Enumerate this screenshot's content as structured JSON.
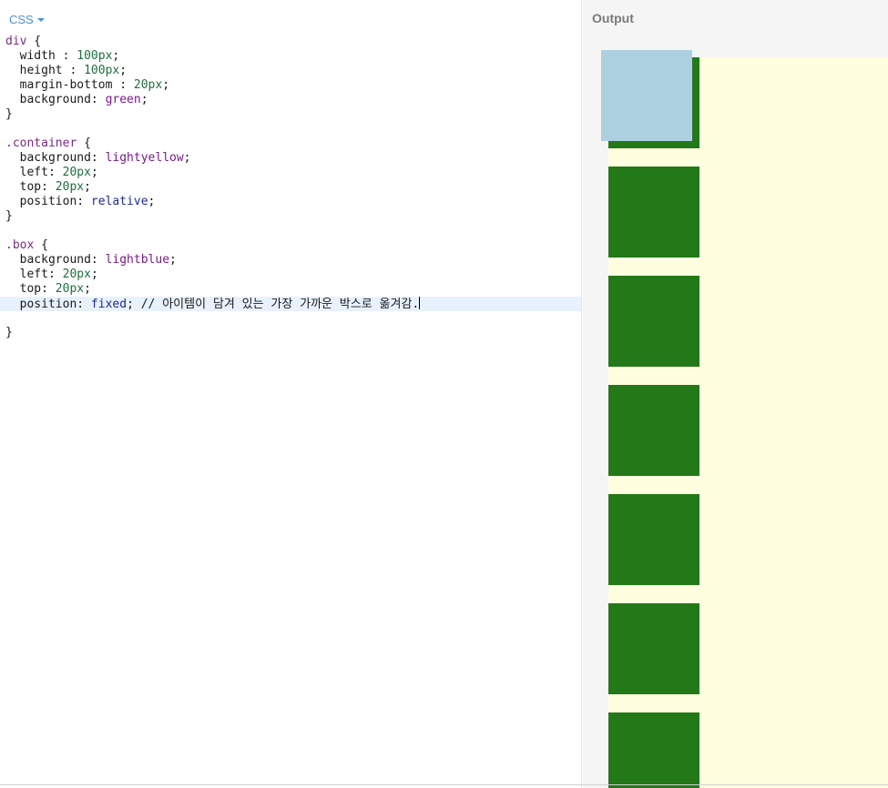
{
  "editor": {
    "language_label": "CSS",
    "lines": [
      [
        [
          "sel",
          "div"
        ],
        [
          "pun",
          " {"
        ]
      ],
      [
        [
          "prop",
          "  width : "
        ],
        [
          "num",
          "100px"
        ],
        [
          "pun",
          ";"
        ]
      ],
      [
        [
          "prop",
          "  height : "
        ],
        [
          "num",
          "100px"
        ],
        [
          "pun",
          ";"
        ]
      ],
      [
        [
          "prop",
          "  margin-bottom : "
        ],
        [
          "num",
          "20px"
        ],
        [
          "pun",
          ";"
        ]
      ],
      [
        [
          "prop",
          "  background: "
        ],
        [
          "kw",
          "green"
        ],
        [
          "pun",
          ";"
        ]
      ],
      [
        [
          "pun",
          "}"
        ]
      ],
      [],
      [
        [
          "sel",
          ".container"
        ],
        [
          "pun",
          " {"
        ]
      ],
      [
        [
          "prop",
          "  background: "
        ],
        [
          "kw",
          "lightyellow"
        ],
        [
          "pun",
          ";"
        ]
      ],
      [
        [
          "prop",
          "  left: "
        ],
        [
          "num",
          "20px"
        ],
        [
          "pun",
          ";"
        ]
      ],
      [
        [
          "prop",
          "  top: "
        ],
        [
          "num",
          "20px"
        ],
        [
          "pun",
          ";"
        ]
      ],
      [
        [
          "prop",
          "  position: "
        ],
        [
          "kwn",
          "relative"
        ],
        [
          "pun",
          ";"
        ]
      ],
      [
        [
          "pun",
          "}"
        ]
      ],
      [],
      [
        [
          "sel",
          ".box"
        ],
        [
          "pun",
          " {"
        ]
      ],
      [
        [
          "prop",
          "  background: "
        ],
        [
          "kw",
          "lightblue"
        ],
        [
          "pun",
          ";"
        ]
      ],
      [
        [
          "prop",
          "  left: "
        ],
        [
          "num",
          "20px"
        ],
        [
          "pun",
          ";"
        ]
      ],
      [
        [
          "prop",
          "  top: "
        ],
        [
          "num",
          "20px"
        ],
        [
          "pun",
          ";"
        ]
      ],
      [
        [
          "prop",
          "  position: "
        ],
        [
          "kwn",
          "fixed"
        ],
        [
          "pun",
          "; "
        ],
        [
          "cmt",
          "// 아이템이 담겨 있는 가장 가까운 박스로 옮겨감."
        ]
      ],
      [],
      [
        [
          "pun",
          "}"
        ]
      ]
    ],
    "active_line": 18
  },
  "output": {
    "title": "Output",
    "green_box_count": 7
  },
  "colors": {
    "accent": "#4a90d9",
    "green_box": "#237818",
    "container_bg": "#ffffdf",
    "fixed_box": "#add0e0",
    "active_line_bg": "#e8f2fe"
  }
}
